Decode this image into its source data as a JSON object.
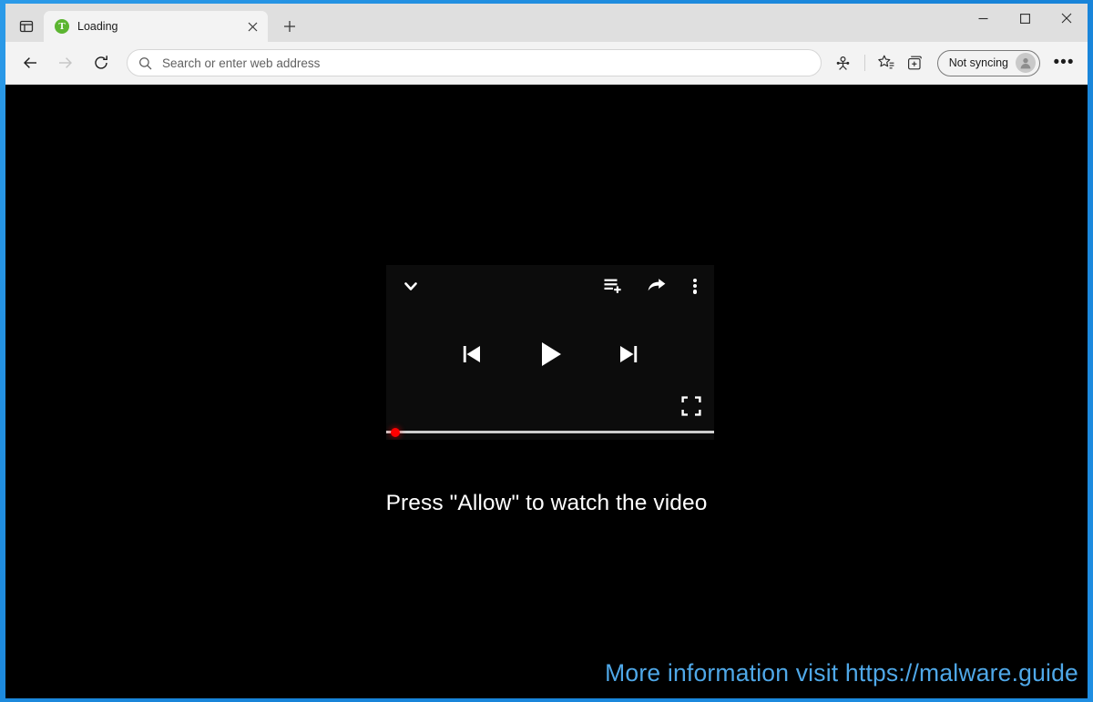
{
  "window": {
    "controls": {
      "minimize_label": "Minimize",
      "maximize_label": "Maximize",
      "close_label": "Close"
    },
    "frame_color": "#1a8ce0"
  },
  "tabstrip": {
    "tab_actions_label": "Tab actions menu",
    "new_tab_label": "New tab",
    "tabs": [
      {
        "title": "Loading",
        "favicon": "green-circle-t-icon",
        "favicon_letter": "T",
        "favicon_color": "#5cb531",
        "close_label": "Close tab",
        "active": true
      }
    ]
  },
  "toolbar": {
    "back_label": "Back",
    "forward_label": "Forward",
    "refresh_label": "Refresh",
    "address_bar": {
      "value": "",
      "placeholder": "Search or enter web address",
      "icon": "search-icon"
    },
    "character_icon_label": "Character",
    "favorites_icon_label": "Favorites",
    "collections_icon_label": "Collections",
    "sync_pill": {
      "label": "Not syncing",
      "avatar": "person-avatar-icon"
    },
    "settings_label": "Settings and more",
    "settings_glyph": "•••"
  },
  "page": {
    "background_color": "#000000",
    "player": {
      "collapse_icon_label": "Collapse player",
      "queue_icon_label": "Add to queue",
      "share_icon_label": "Share",
      "kebab_icon_label": "More options",
      "previous_label": "Previous track",
      "play_label": "Play",
      "next_label": "Next track",
      "fullscreen_label": "Fullscreen",
      "progress_percent": 0,
      "progress_color": "#ff0000",
      "track_color": "#cfcfcf",
      "panel_color": "#0c0c0c"
    },
    "message": "Press \"Allow\" to watch the video",
    "message_color": "#ffffff",
    "watermark": "More information visit https://malware.guide",
    "watermark_color": "#4fa8e8"
  }
}
